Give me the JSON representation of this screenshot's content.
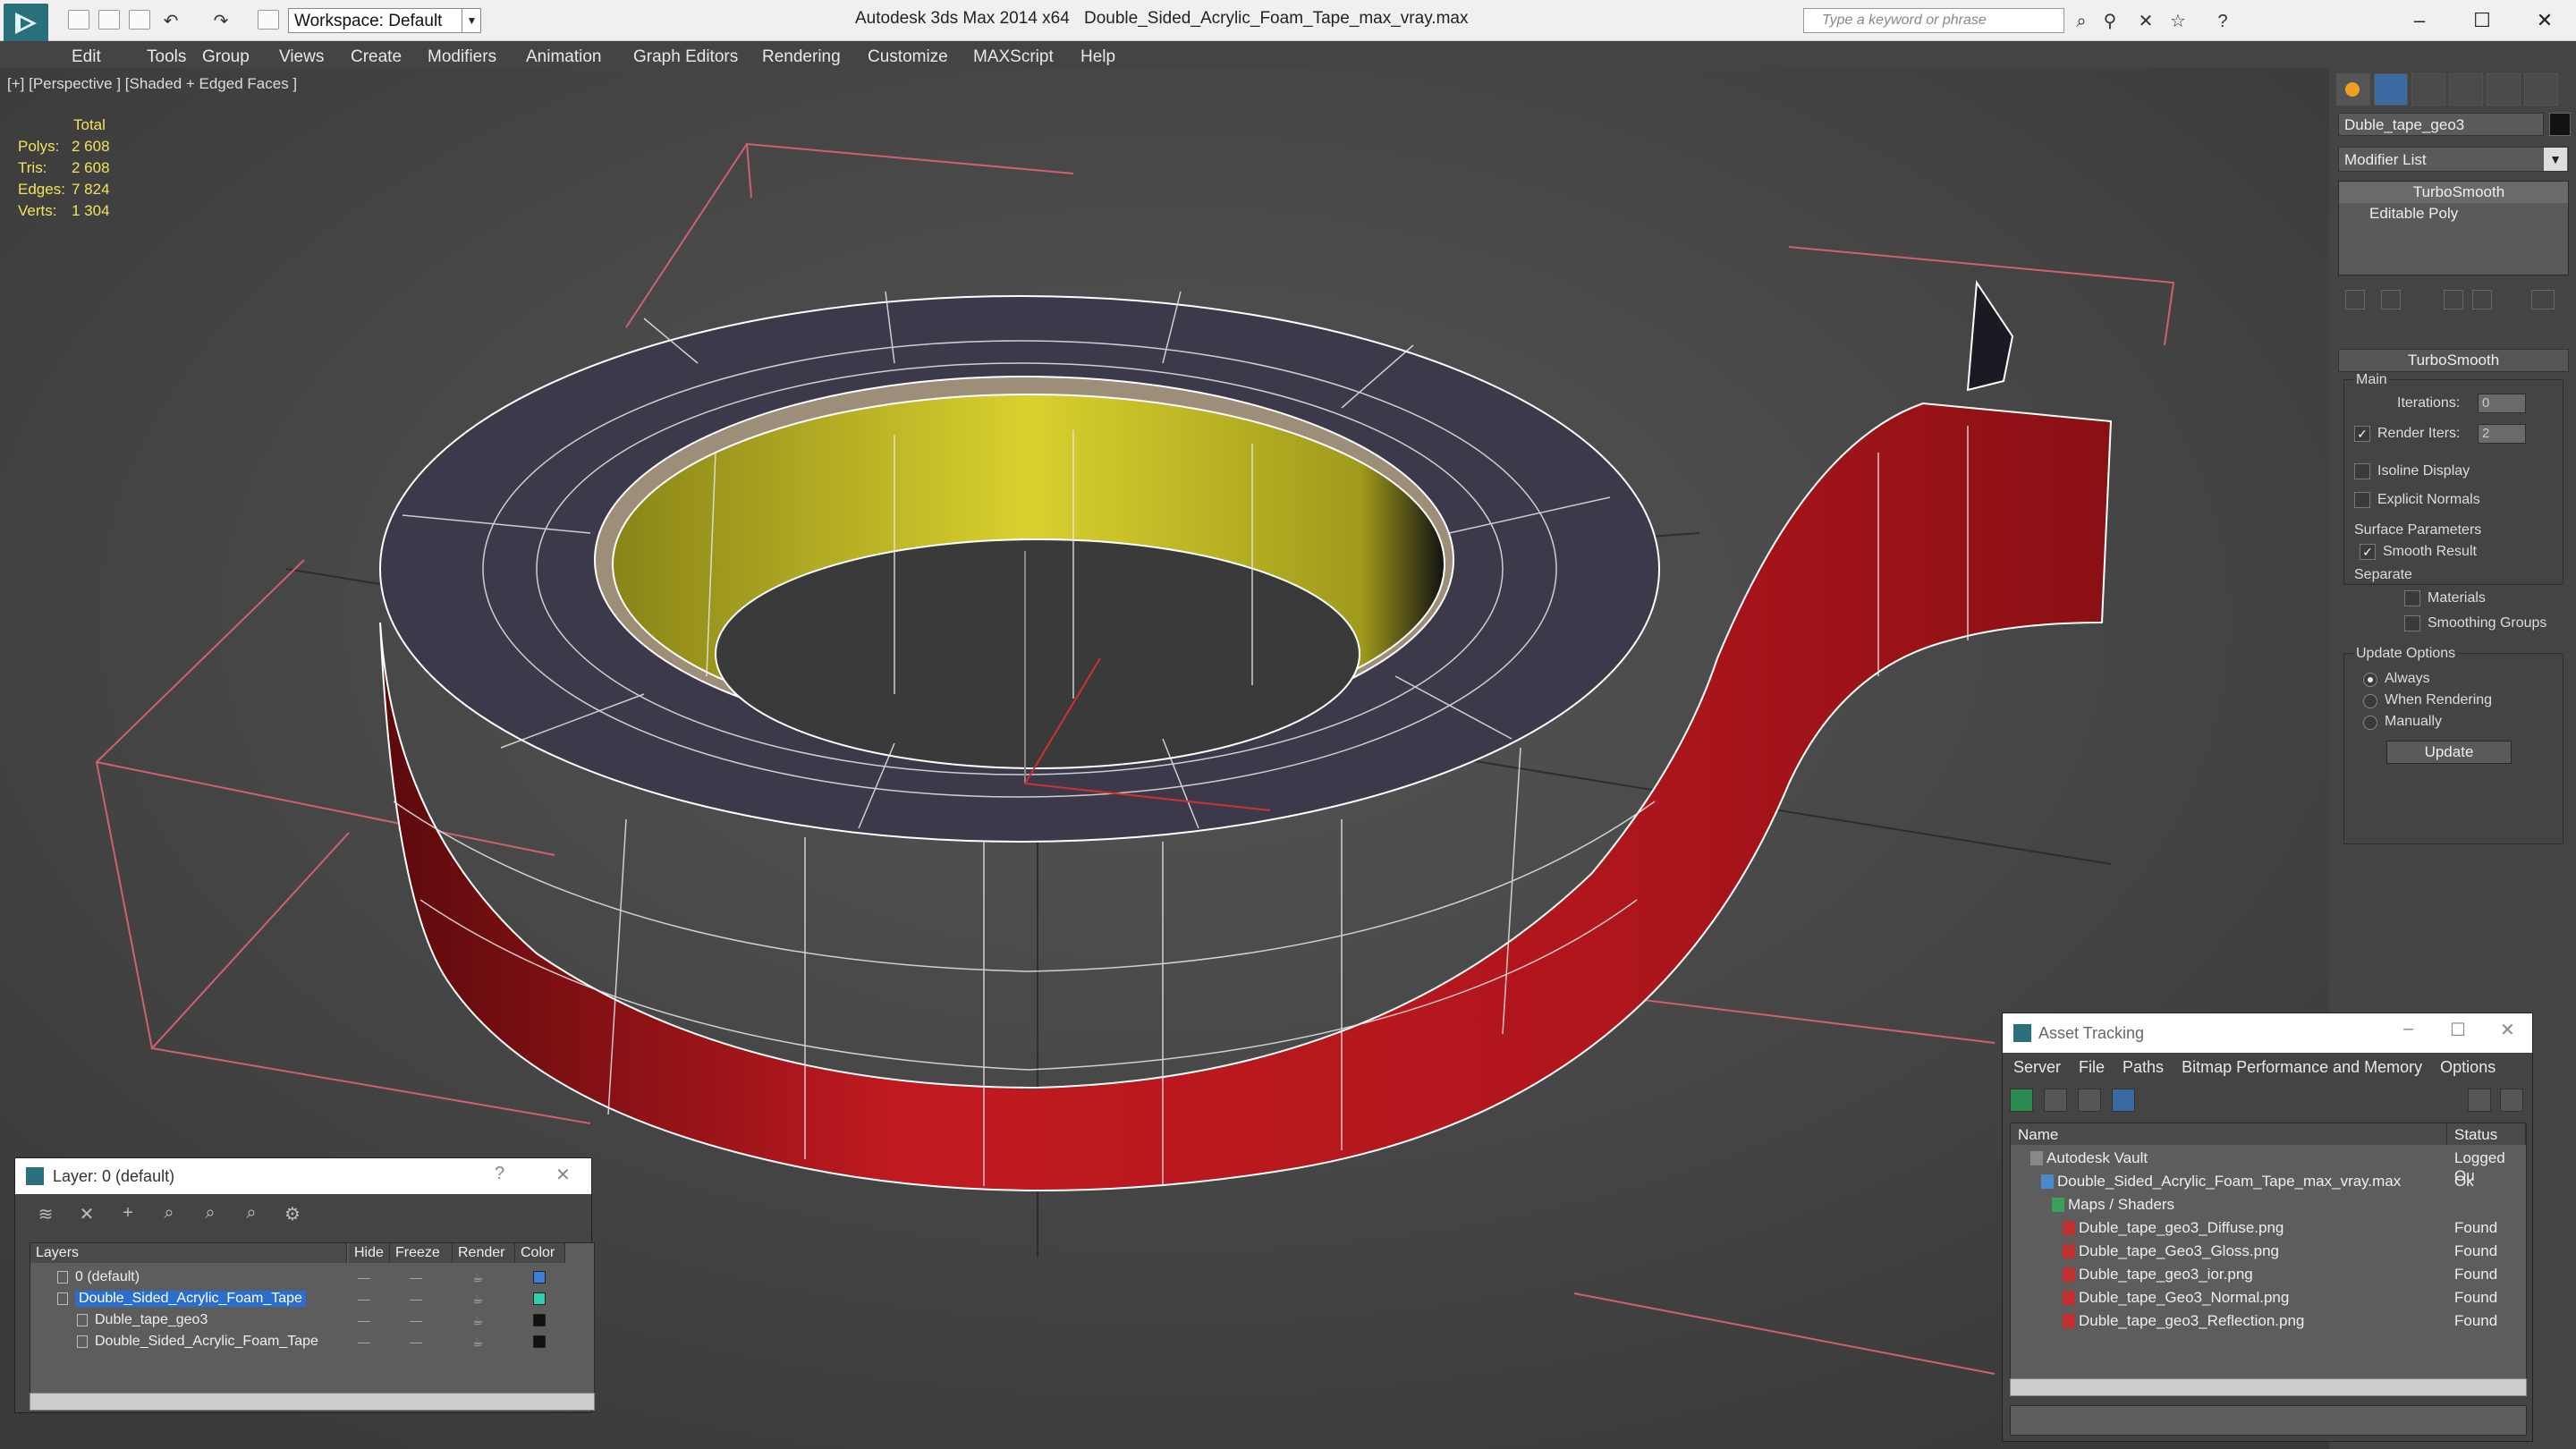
{
  "titlebar": {
    "workspace": "Workspace: Default",
    "app_title": "Autodesk 3ds Max  2014 x64",
    "file_title": "Double_Sided_Acrylic_Foam_Tape_max_vray.max",
    "search_placeholder": "Type a keyword or phrase"
  },
  "menu": [
    "Edit",
    "Tools",
    "Group",
    "Views",
    "Create",
    "Modifiers",
    "Animation",
    "Graph Editors",
    "Rendering",
    "Customize",
    "MAXScript",
    "Help"
  ],
  "viewport": {
    "label": "[+] [Perspective ] [Shaded + Edged Faces ]",
    "stats": {
      "header": "Total",
      "polys_label": "Polys:",
      "polys": "2 608",
      "tris_label": "Tris:",
      "tris": "2 608",
      "edges_label": "Edges:",
      "edges": "7 824",
      "verts_label": "Verts:",
      "verts": "1 304"
    }
  },
  "command_panel": {
    "object_name": "Duble_tape_geo3",
    "modifier_list": "Modifier List",
    "stack": [
      "TurboSmooth",
      "Editable Poly"
    ],
    "rollout_title": "TurboSmooth",
    "main_label": "Main",
    "iterations_label": "Iterations:",
    "iterations_value": "0",
    "render_iters_label": "Render Iters:",
    "render_iters_value": "2",
    "isoline_label": "Isoline Display",
    "explicit_label": "Explicit Normals",
    "surface_label": "Surface Parameters",
    "smooth_result_label": "Smooth Result",
    "separate_label": "Separate",
    "materials_label": "Materials",
    "smoothing_groups_label": "Smoothing Groups",
    "update_options_label": "Update Options",
    "always_label": "Always",
    "when_rendering_label": "When Rendering",
    "manually_label": "Manually",
    "update_button": "Update"
  },
  "layer_dialog": {
    "title": "Layer: 0 (default)",
    "help": "?",
    "close": "✕",
    "columns": [
      "Layers",
      "Hide",
      "Freeze",
      "Render",
      "Color"
    ],
    "rows": [
      {
        "name": "0 (default)",
        "indent": 0,
        "color": "#3a7fd8"
      },
      {
        "name": "Double_Sided_Acrylic_Foam_Tape",
        "indent": 0,
        "color": "#2ecfb0"
      },
      {
        "name": "Duble_tape_geo3",
        "indent": 1,
        "color": "#111111"
      },
      {
        "name": "Double_Sided_Acrylic_Foam_Tape",
        "indent": 1,
        "color": "#111111"
      }
    ]
  },
  "asset_dialog": {
    "title": "Asset Tracking",
    "menu": [
      "Server",
      "File",
      "Paths",
      "Bitmap Performance and Memory",
      "Options"
    ],
    "columns": [
      "Name",
      "Status"
    ],
    "rows": [
      {
        "name": "Autodesk Vault",
        "status": "Logged Ou",
        "indent": 1
      },
      {
        "name": "Double_Sided_Acrylic_Foam_Tape_max_vray.max",
        "status": "Ok",
        "indent": 2
      },
      {
        "name": "Maps / Shaders",
        "status": "",
        "indent": 3
      },
      {
        "name": "Duble_tape_geo3_Diffuse.png",
        "status": "Found",
        "indent": 4
      },
      {
        "name": "Duble_tape_Geo3_Gloss.png",
        "status": "Found",
        "indent": 4
      },
      {
        "name": "Duble_tape_geo3_ior.png",
        "status": "Found",
        "indent": 4
      },
      {
        "name": "Duble_tape_Geo3_Normal.png",
        "status": "Found",
        "indent": 4
      },
      {
        "name": "Duble_tape_geo3_Reflection.png",
        "status": "Found",
        "indent": 4
      }
    ]
  },
  "colors": {
    "viewport_bg": "#474747",
    "tape_red": "#b0161c",
    "tape_top": "#3c3a4a",
    "tape_inner": "#c9c12a",
    "stats_yellow": "#f4e25a",
    "selection_blue": "#2a6fd0"
  }
}
